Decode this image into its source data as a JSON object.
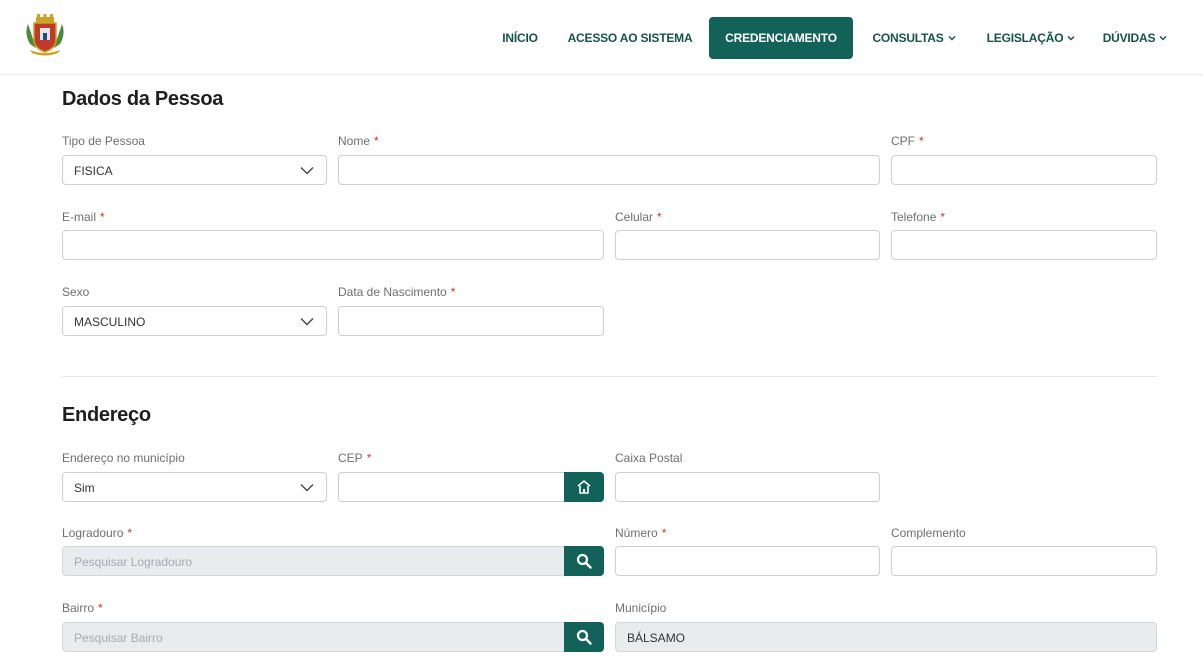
{
  "colors": {
    "brand": "#13625a",
    "nav_text": "#17524a",
    "required": "#c0392b"
  },
  "header": {
    "logo_icon": "municipal-coat-of-arms",
    "nav": {
      "inicio": "INÍCIO",
      "acesso": "ACESSO AO SISTEMA",
      "credenciamento": "CREDENCIAMENTO",
      "consultas": "CONSULTAS",
      "legislacao": "LEGISLAÇÃO",
      "duvidas": "DÚVIDAS"
    },
    "active": "CREDENCIAMENTO"
  },
  "pessoa": {
    "title": "Dados da Pessoa",
    "tipo_label": "Tipo de Pessoa",
    "tipo_value": "FISICA",
    "nome_label": "Nome",
    "cpf_label": "CPF",
    "email_label": "E-mail",
    "celular_label": "Celular",
    "telefone_label": "Telefone",
    "sexo_label": "Sexo",
    "sexo_value": "MASCULINO",
    "nascimento_label": "Data de Nascimento",
    "required_mark": "*"
  },
  "endereco": {
    "title": "Endereço",
    "municipio_sel_label": "Endereço no município",
    "municipio_sel_value": "Sim",
    "cep_label": "CEP",
    "caixa_label": "Caixa Postal",
    "logradouro_label": "Logradouro",
    "logradouro_placeholder": "Pesquisar Logradouro",
    "numero_label": "Número",
    "complemento_label": "Complemento",
    "bairro_label": "Bairro",
    "bairro_placeholder": "Pesquisar Bairro",
    "municipio_label": "Município",
    "municipio_value": "BÁLSAMO",
    "required_mark": "*"
  }
}
